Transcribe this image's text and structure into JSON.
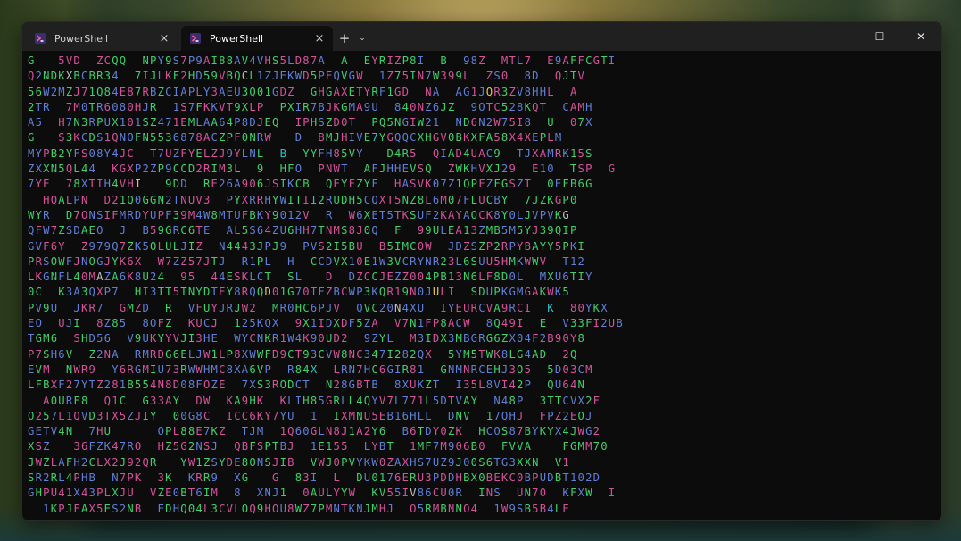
{
  "window": {
    "tabs": [
      {
        "label": "PowerShell",
        "active": false
      },
      {
        "label": "PowerShell",
        "active": true
      }
    ],
    "new_tab_label": "+",
    "dropdown_label": "⌄",
    "controls": {
      "minimize": "—",
      "maximize": "☐",
      "close": "✕"
    }
  },
  "terminal": {
    "palette": [
      "#3ad06a",
      "#29c2c7",
      "#d5519a",
      "#e6c449",
      "#5f7fd8",
      "#c0c0c0"
    ],
    "lines": [
      "G   5VD  ZCQQ  NPY9S7P9AI88AV4VHS5LD87A  A  EYRIZP8I  B  98Z  MTL7  E9AFFCGTI",
      "Q2NDKXBCBR34  7IJLKF2HD59VBQCL1ZJEKWD5PEQVGW  1Z75IN7W399L  ZS0  8D  QJTV",
      "56W2MZJ71Q84E87RBZCIAPLY3AEU3Q01GDZ  GHGAXETYRF1GD  NA  AG1JQR3ZV8HHL  A",
      "2TR  7M0TR6080HJR  1S7FKKVT9XLP  PXIR7BJKGMA9U  840NZ6JZ  9OTC528KQT  CAMH",
      "A5  H7N3RPUX101SZ471EMLAA64P8DJEQ  IPHSZD0T  PQ5NGIW21  ND6N2W75I8  U  07X",
      "G   S3KCDS1QNOFN5536878ACZPF0NRW   D  BMJHIVE7YGQQCXHGV0BKXFA58X4XEPLM",
      "MYPB2YFS08Y4JC  T7UZFYELZJ9YLNL  B  YYFH85VY   D4R5  QIAD4UAC9  TJXAMRK15S",
      "ZXXN5QL44  KGXP2ZP9CCD2RIM3L  9  HFO  PNWT  AFJHHEVSQ  ZWKHVXJ29  E10  TSP  G",
      "7YE  78XTIH4VHI   9DD  RE26A906JSIKCB  QEYFZYF  HASVK07Z1QPFZFGSZT  0EFB6G",
      "  HQALPN  D21Q0GGN2TNUV3  PYXRRHYWITII2RUDH5CQXT5NZ8L6M07FLUCBY  7JZKGP0",
      "WYR  D7ONSIFMRDYUPF39M4W8MTUFBKY9012V  R  W6XET5TKSUF2KAYAOCK8Y0LJVPVKG",
      "QFW7ZSDAEO  J  B59GRC6TE  AL5S64ZU6HH7TNMS8J0Q  F  99ULEA13ZMB5M5YJ39QIP",
      "GVF6Y  Z979Q7ZK5OLULJIZ  N4443JPJ9  PVS2I5BU  B5IMC0W  JDZSZP2RPYBAYY5PKI",
      "PRSOWFJNOGJYK6X  W7ZZ57JTJ  R1PL  H  CCDVX10E1W3VCRYNR23L6SUU5HMKWWV  T12",
      "LKGNFL40MAZA6K8U24  95  44ESKLCT  SL   D  DZCCJEZZ004PB13N6LF8D0L  MXU6TIY",
      "0C  K3A3QXP7  HI3TT5TNYDTEY8RQQD01G70TFZBCWP3KQR19N0JULI  SDUPKGMGAKWK5",
      "PV9U  JKR7  GMZD  R  VFUYJRJW2  MR0HC6PJV  QVC20N4XU  IYEURCVA9RCI  K  80YKX",
      "EO  UJI  8Z85  8OFZ  KUCJ  125KQX  9X1IDXDF5ZA  V7N1FP8ACW  8Q49I  E  V33FI2UB",
      "TGM6  SHD56  V9UKYYVJI3HE  WYCNKR1W4K90UD2  9ZYL  M3IDX3MBGRG6ZX04F2B90Y8",
      "P7SH6V  Z2NA  RMRDG6ELJW1LP8XWWFD9CT93CVW8NC347I282QX  5YM5TWK8LG4AD  2Q",
      "EVM  NWR9  Y6RGMIU73RWWHMC8XA6VP  R84X  LRN7HC6GIR81  GNMNRCEHJ3O5  5D03CM",
      "LFBXF27YTZ281B554N8D08FOZE  7XS3RODCT  N28GBTB  8XUKZT  I35L8VI42P  QU64N",
      "  A0URF8  Q1C  G33AY  DW  KA9HK  KLIH85GRLL4QYV7L771L5DTVAY  N48P  3TTCVX2F",
      "O257L1QVD3TX5ZJIY  00G8C  ICC6KY7YU  1  IXMNU5EB16HLL  DNV  17QHJ  FPZ2EOJ",
      "GETV4N  7HU      OPL88E7KZ  TJM  1Q60GLN8J1A2Y6  B6TDY0ZK  HCOS87BYKYX4JWG2",
      "XSZ   36FZK47RO  HZ5G2NSJ  QBFSPTBJ  1E155  LYBT  1MF7M906B0  FVVA    FGMM70",
      "JWZLAFH2CLX2J92QR   YW1ZSYDE8ONSJIB  VWJ0PVYKW0ZAXHS7UZ9J00S6TG3XXN  V1",
      "SR2RL4PHB  N7PK  3K  KRR9  XG   G  83I  L  DU0176ERU3PDDHBX0BEKC0BPUDBT102D",
      "GHPU41X43PLXJU  VZE0BT6IM  8  XNJ1  0AULYYW  KV55IV86CU0R  INS  UN70  KFXW  I",
      "  1KPJFAX5ES2NB  EDHQ04L3CVLOQ9HOU8WZ7PMNTKNJMHJ  O5RMBNNO4  1W9SB5B4LE"
    ]
  }
}
